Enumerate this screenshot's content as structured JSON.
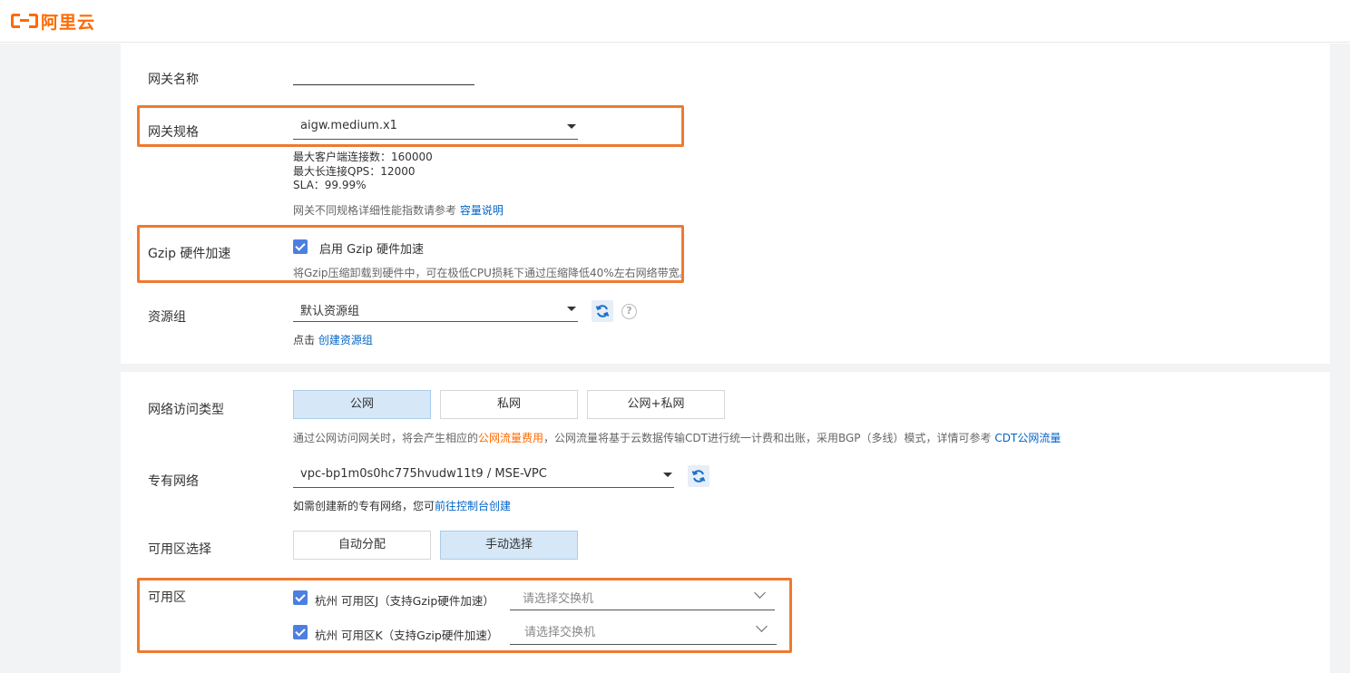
{
  "brand": {
    "logo_text": "阿里云",
    "accent": "#ff6a00"
  },
  "gateway_name": {
    "label": "网关名称",
    "value": ""
  },
  "gateway_spec": {
    "label": "网关规格",
    "value": "aigw.medium.x1",
    "details": [
      "最大客户端连接数：160000",
      "最大长连接QPS：12000",
      "SLA：99.99%"
    ],
    "ref_text": "网关不同规格详细性能指数请参考",
    "ref_link": "容量说明"
  },
  "gzip": {
    "label": "Gzip 硬件加速",
    "checkbox_label": "启用 Gzip 硬件加速",
    "checked": true,
    "desc": "将Gzip压缩卸载到硬件中，可在极低CPU损耗下通过压缩降低40%左右网络带宽。"
  },
  "resource_group": {
    "label": "资源组",
    "value": "默认资源组",
    "hint_prefix": "点击",
    "hint_link": "创建资源组"
  },
  "network_type": {
    "label": "网络访问类型",
    "options": [
      "公网",
      "私网",
      "公网+私网"
    ],
    "selected": "公网",
    "desc_1": "通过公网访问网关时，将会产生相应的",
    "desc_link_1": "公网流量费用",
    "desc_2": "，公网流量将基于云数据传输CDT进行统一计费和出账，采用BGP（多线）模式，详情可参考",
    "desc_link_2": "CDT公网流量"
  },
  "vpc": {
    "label": "专有网络",
    "value": "vpc-bp1m0s0hc775hvudw11t9 / MSE-VPC",
    "hint_prefix": "如需创建新的专有网络，您可",
    "hint_link": "前往控制台创建"
  },
  "zone_select": {
    "label": "可用区选择",
    "options": [
      "自动分配",
      "手动选择"
    ],
    "selected": "手动选择"
  },
  "zones": {
    "label": "可用区",
    "items": [
      {
        "label": "杭州 可用区J（支持Gzip硬件加速）",
        "checked": true,
        "placeholder": "请选择交换机"
      },
      {
        "label": "杭州 可用区K（支持Gzip硬件加速）",
        "checked": true,
        "placeholder": "请选择交换机"
      }
    ]
  },
  "highlight_color": "#ee7a30"
}
